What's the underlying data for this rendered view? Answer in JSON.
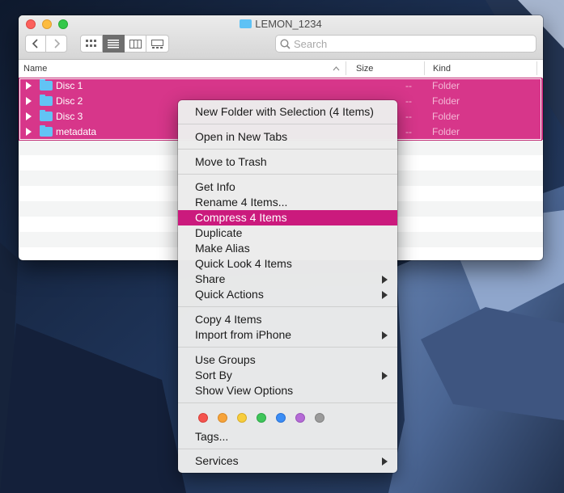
{
  "window": {
    "title": "LEMON_1234",
    "search_placeholder": "Search"
  },
  "columns": {
    "name": "Name",
    "size": "Size",
    "kind": "Kind"
  },
  "rows": [
    {
      "name": "Disc 1",
      "size": "--",
      "kind": "Folder"
    },
    {
      "name": "Disc 2",
      "size": "--",
      "kind": "Folder"
    },
    {
      "name": "Disc 3",
      "size": "--",
      "kind": "Folder"
    },
    {
      "name": "metadata",
      "size": "--",
      "kind": "Folder"
    }
  ],
  "menu": {
    "new_folder": "New Folder with Selection (4 Items)",
    "open_tabs": "Open in New Tabs",
    "trash": "Move to Trash",
    "get_info": "Get Info",
    "rename": "Rename 4 Items...",
    "compress": "Compress 4 Items",
    "duplicate": "Duplicate",
    "alias": "Make Alias",
    "quick_look": "Quick Look 4 Items",
    "share": "Share",
    "quick_actions": "Quick Actions",
    "copy": "Copy 4 Items",
    "import": "Import from iPhone",
    "use_groups": "Use Groups",
    "sort_by": "Sort By",
    "view_options": "Show View Options",
    "tags": "Tags...",
    "services": "Services"
  },
  "tag_colors": [
    "#f4534e",
    "#f6a33a",
    "#f7cd3d",
    "#3fc55a",
    "#3b8df5",
    "#b56bd6",
    "#9b9b9b"
  ],
  "colors": {
    "selection": "#d7368a",
    "menu_highlight": "#cb1a7d"
  }
}
